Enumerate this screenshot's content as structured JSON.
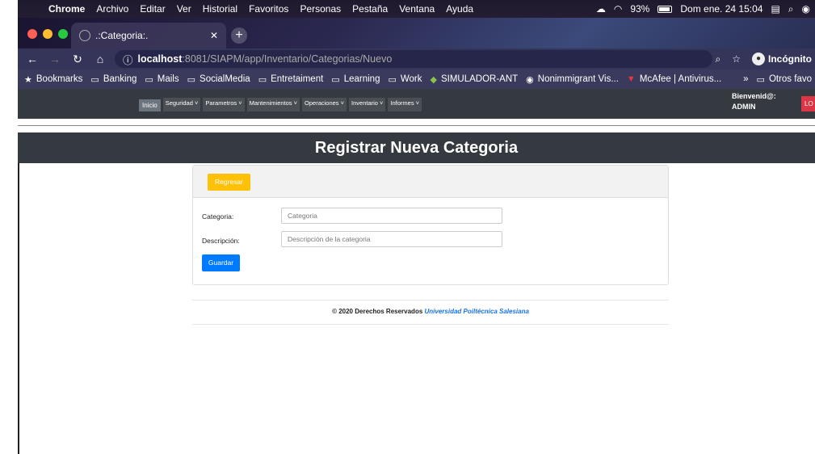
{
  "macos_menu": {
    "app": "Chrome",
    "items": [
      "Archivo",
      "Editar",
      "Ver",
      "Historial",
      "Favoritos",
      "Personas",
      "Pestaña",
      "Ventana",
      "Ayuda"
    ],
    "battery": "93%",
    "clock": "Dom ene. 24  15:04"
  },
  "browser": {
    "tab_title": ".:Categoria:.",
    "url_host": "localhost",
    "url_rest": ":8081/SIAPM/app/Inventario/Categorias/Nuevo",
    "incognito_label": "Incógnito",
    "bookmarks": [
      "Bookmarks",
      "Banking",
      "Mails",
      "SocialMedia",
      "Entretaiment",
      "Learning",
      "Work",
      "SIMULADOR-ANT",
      "Nonimmigrant Vis...",
      "McAfee | Antivirus..."
    ],
    "other_bookmarks": "Otros favo"
  },
  "appnav": {
    "inicio": "Inicio",
    "menus": [
      "Seguridad ˅",
      "Parametros ˅",
      "Mantenimientos ˅",
      "Operaciones ˅",
      "Inventario ˅",
      "Informes ˅"
    ],
    "welcome": "Bienvenid@:",
    "user": "ADMIN",
    "logout": "LO"
  },
  "page": {
    "title": "Registrar Nueva Categoria",
    "back_button": "Regresar",
    "categoria_label": "Categoria:",
    "categoria_placeholder": "Categoria",
    "descripcion_label": "Descripción:",
    "descripcion_placeholder": "Descripción de la categoria",
    "save_button": "Guardar"
  },
  "footer": {
    "text": "© 2020 Derechos Reservados",
    "university": "Universidad Poiltécnica Salesiana"
  },
  "colors": {
    "navbar": "#343a40",
    "warning": "#ffc107",
    "primary": "#007bff",
    "danger": "#dc3545"
  }
}
